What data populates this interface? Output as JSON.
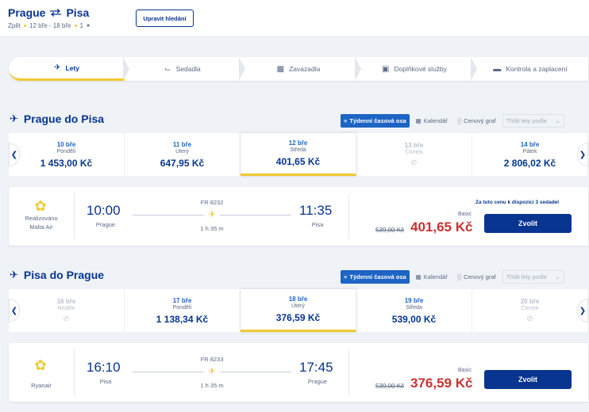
{
  "header": {
    "origin": "Prague",
    "destination": "Pisa",
    "trip_type": "Zpět",
    "dates": "12 bře - 18 bře",
    "passengers": "1",
    "modify_label": "Upravit hledání"
  },
  "stepper": {
    "steps": [
      {
        "label": "Lety",
        "icon": "plane-icon",
        "active": true
      },
      {
        "label": "Sedadla",
        "icon": "seat-icon",
        "active": false
      },
      {
        "label": "Zavazadla",
        "icon": "luggage-icon",
        "active": false
      },
      {
        "label": "Doplňkové služby",
        "icon": "monitor-icon",
        "active": false
      },
      {
        "label": "Kontrola a zaplacení",
        "icon": "card-icon",
        "active": false
      }
    ]
  },
  "view_tabs": {
    "weekly": "Týdenní časová osa",
    "calendar": "Kalendář",
    "price_chart": "Cenový graf",
    "sort_placeholder": "Třídit lety podle"
  },
  "outbound": {
    "title": "Prague do Pisa",
    "dates": [
      {
        "date": "10 bře",
        "day": "Pondělí",
        "price": "1 453,00 Kč",
        "disabled": false,
        "selected": false
      },
      {
        "date": "11 bře",
        "day": "Úterý",
        "price": "647,95 Kč",
        "disabled": false,
        "selected": false
      },
      {
        "date": "12 bře",
        "day": "Středa",
        "price": "401,65 Kč",
        "disabled": false,
        "selected": true
      },
      {
        "date": "13 bře",
        "day": "Čtvrtek",
        "price": "",
        "disabled": true,
        "selected": false
      },
      {
        "date": "14 bře",
        "day": "Pátek",
        "price": "2 806,02 Kč",
        "disabled": false,
        "selected": false
      }
    ],
    "flight": {
      "operator_line1": "Realizováno",
      "operator_line2": "Malta Air",
      "depart_time": "10:00",
      "depart_city": "Prague",
      "flight_no": "FR 8232",
      "duration": "1 h 35 m",
      "arrive_time": "11:35",
      "arrive_city": "Pisa",
      "seat_note": "Za tuto cenu k dispozici 3 sedadel",
      "fare_type": "Basic",
      "old_price": "539,00 Kč",
      "price": "401,65 Kč",
      "select_label": "Zvolit"
    }
  },
  "inbound": {
    "title": "Pisa do Prague",
    "dates": [
      {
        "date": "16 bře",
        "day": "Neděle",
        "price": "",
        "disabled": true,
        "selected": false
      },
      {
        "date": "17 bře",
        "day": "Pondělí",
        "price": "1 138,34 Kč",
        "disabled": false,
        "selected": false
      },
      {
        "date": "18 bře",
        "day": "Úterý",
        "price": "376,59 Kč",
        "disabled": false,
        "selected": true
      },
      {
        "date": "19 bře",
        "day": "Středa",
        "price": "539,00 Kč",
        "disabled": false,
        "selected": false
      },
      {
        "date": "20 bře",
        "day": "Čtvrtek",
        "price": "",
        "disabled": true,
        "selected": false
      }
    ],
    "flight": {
      "operator_line1": "Ryanair",
      "depart_time": "16:10",
      "depart_city": "Pisa",
      "flight_no": "FR 8233",
      "duration": "1 h 35 m",
      "arrive_time": "17:45",
      "arrive_city": "Prague",
      "fare_type": "Basic",
      "old_price": "539,00 Kč",
      "price": "376,59 Kč",
      "select_label": "Zvolit"
    }
  },
  "colors": {
    "brand_blue": "#073590",
    "accent_yellow": "#f1c933",
    "price_red": "#c83232",
    "tab_blue": "#1d64c4"
  }
}
